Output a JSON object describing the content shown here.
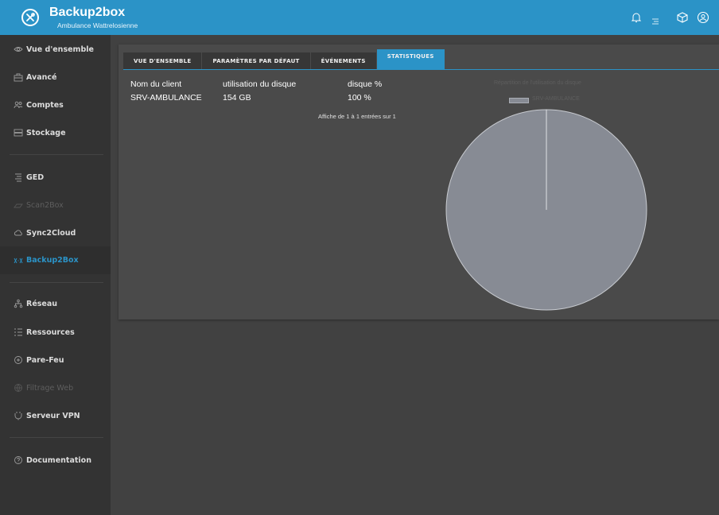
{
  "header": {
    "title": "Backup2box",
    "subtitle": "Ambulance Wattrelosienne",
    "icons": [
      "bell-icon",
      "list-icon",
      "cube-icon",
      "user-circle-icon"
    ],
    "brand_color": "#2b93c7"
  },
  "sidebar": {
    "items": [
      {
        "label": "Vue d'ensemble",
        "icon": "eye-icon",
        "state": "normal"
      },
      {
        "label": "Avancé",
        "icon": "briefcase-icon",
        "state": "normal"
      },
      {
        "label": "Comptes",
        "icon": "users-icon",
        "state": "normal"
      },
      {
        "label": "Stockage",
        "icon": "storage-icon",
        "state": "normal"
      },
      {
        "label": "GED",
        "icon": "document-icon",
        "state": "normal"
      },
      {
        "label": "Scan2Box",
        "icon": "scanner-icon",
        "state": "disabled"
      },
      {
        "label": "Sync2Cloud",
        "icon": "cloud-icon",
        "state": "normal"
      },
      {
        "label": "Backup2Box",
        "icon": "backup-icon",
        "state": "active"
      },
      {
        "label": "Réseau",
        "icon": "network-icon",
        "state": "normal"
      },
      {
        "label": "Ressources",
        "icon": "list-icon",
        "state": "normal"
      },
      {
        "label": "Pare-Feu",
        "icon": "shield-icon",
        "state": "normal"
      },
      {
        "label": "Filtrage Web",
        "icon": "globe-icon",
        "state": "disabled"
      },
      {
        "label": "Serveur VPN",
        "icon": "vpn-icon",
        "state": "normal"
      },
      {
        "label": "Documentation",
        "icon": "help-icon",
        "state": "normal"
      }
    ]
  },
  "tabs": [
    {
      "label": "VUE D'ENSEMBLE",
      "active": false
    },
    {
      "label": "PARAMÈTRES PAR DÉFAUT",
      "active": false
    },
    {
      "label": "ÉVÉNEMENTS",
      "active": false
    },
    {
      "label": "STATISTIQUES",
      "active": true
    }
  ],
  "table": {
    "columns": [
      "Nom du client",
      "utilisation du disque",
      "disque %"
    ],
    "rows": [
      [
        "SRV-AMBULANCE",
        "154 GB",
        "100 %"
      ]
    ],
    "info": "Affiche de 1 à 1 entrées sur 1"
  },
  "chart": {
    "title": "Répartition de l'utilisation du disque",
    "legend": "SRV-AMBULANCE",
    "slice_color": "#878b94"
  },
  "chart_data": {
    "type": "pie",
    "title": "Répartition de l'utilisation du disque",
    "categories": [
      "SRV-AMBULANCE"
    ],
    "values": [
      100
    ]
  }
}
